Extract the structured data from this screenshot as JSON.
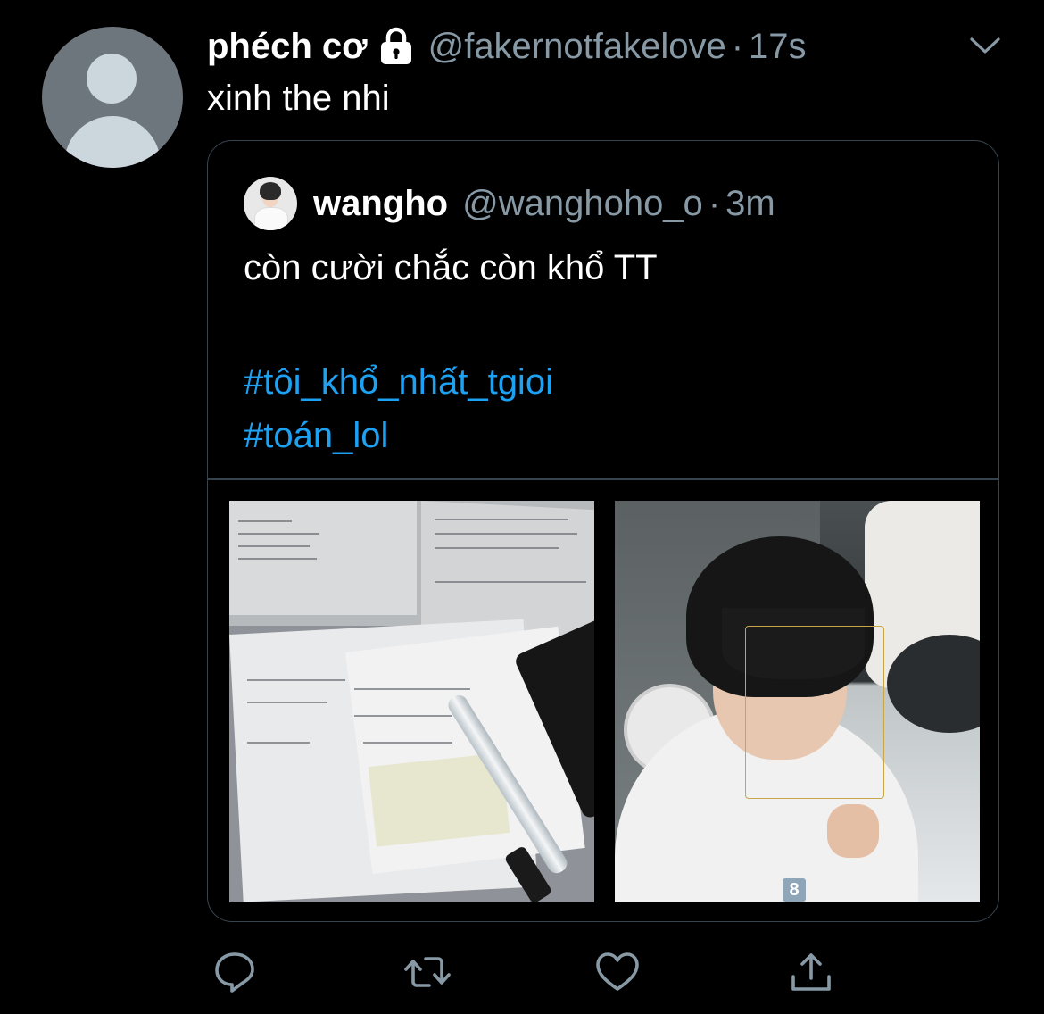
{
  "tweet": {
    "display_name": "phéch cơ",
    "handle": "@fakernotfakelove",
    "separator": "·",
    "time": "17s",
    "text": "xinh the nhi",
    "protected": true
  },
  "quoted_tweet": {
    "display_name": "wangho",
    "handle": "@wanghoho_o",
    "separator": "·",
    "time": "3m",
    "text": "còn cười chắc còn khổ TT",
    "hashtags": [
      "#tôi_khổ_nhất_tgioi",
      "#toán_lol"
    ],
    "media": {
      "photo2_badge": "8"
    }
  },
  "colors": {
    "background": "#000000",
    "text": "#ffffff",
    "secondary": "#8899a6",
    "link": "#1da1f2",
    "border": "#38444d"
  },
  "icons": {
    "actions": [
      "reply-icon",
      "retweet-icon",
      "like-icon",
      "share-icon"
    ],
    "menu": "chevron-down-icon",
    "protected": "lock-icon"
  }
}
